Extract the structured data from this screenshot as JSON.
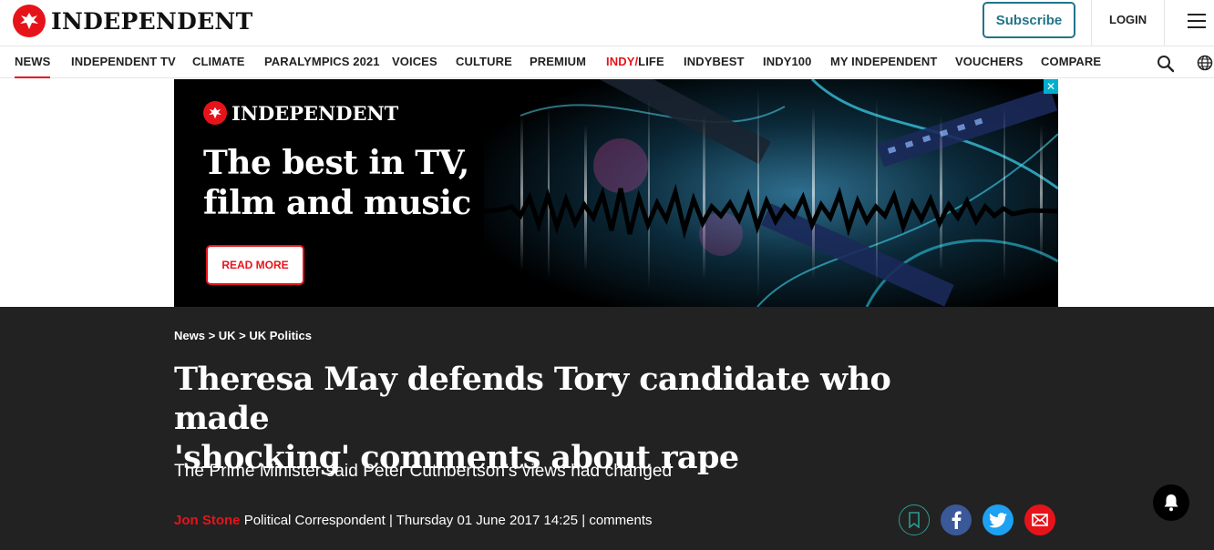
{
  "header": {
    "logo_text": "INDEPENDENT",
    "subscribe_label": "Subscribe",
    "login_label": "LOGIN",
    "brand_color": "#e7131a",
    "accent_color": "#237489"
  },
  "nav": {
    "items": [
      {
        "label": "NEWS"
      },
      {
        "label": "INDEPENDENT TV"
      },
      {
        "label": "CLIMATE"
      },
      {
        "label": "PARALYMPICS 2021"
      },
      {
        "label": "VOICES"
      },
      {
        "label": "CULTURE"
      },
      {
        "label": "PREMIUM"
      },
      {
        "label_prefix": "INDY/",
        "label_suffix": "LIFE"
      },
      {
        "label": "INDYBEST"
      },
      {
        "label": "INDY100"
      },
      {
        "label": "MY INDEPENDENT"
      },
      {
        "label": "VOUCHERS"
      },
      {
        "label": "COMPARE"
      }
    ],
    "active": "NEWS",
    "icons": [
      "search-icon",
      "globe-icon"
    ]
  },
  "ad": {
    "logo_text": "INDEPENDENT",
    "headline_line1": "The best in TV,",
    "headline_line2": "film and music",
    "button_label": "READ MORE",
    "close_glyph": "✕"
  },
  "article": {
    "breadcrumb": "News > UK > UK Politics",
    "headline_line1": "Theresa May defends Tory candidate who made",
    "headline_line2": "'shocking' comments about rape",
    "standfirst": "The Prime Minister said Peter Cuthbertson's views had changed",
    "author": "Jon Stone",
    "author_role": "Political Correspondent",
    "date": "Thursday 01 June 2017 14:25",
    "comments_label": "comments",
    "share_icons": [
      "bookmark-icon",
      "facebook-icon",
      "twitter-icon",
      "email-icon"
    ]
  }
}
